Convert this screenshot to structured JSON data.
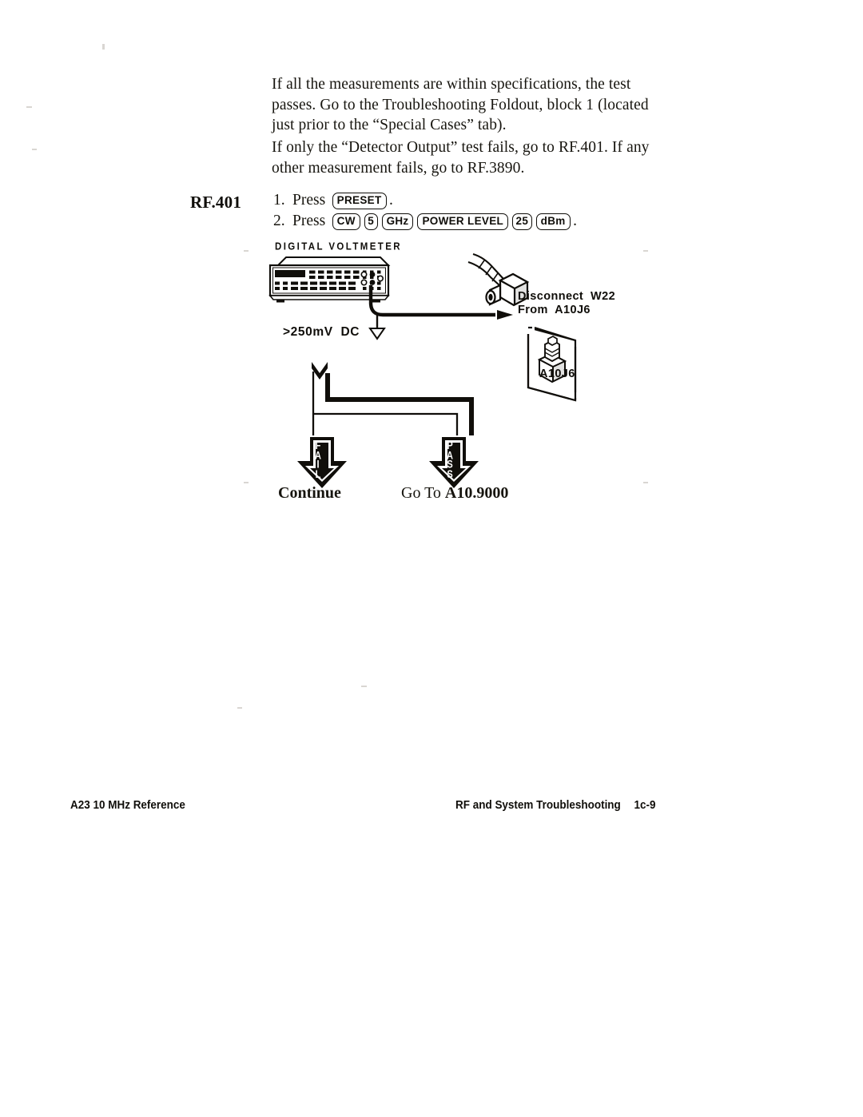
{
  "document": {
    "paragraphs": [
      "If all the measurements are within specifications, the test passes. Go to the Troubleshooting Foldout, block 1 (located just prior to the “Special Cases” tab).",
      "If only the “Detector Output” test fails, go to RF.401. If any other measurement fails, go to RF.3890."
    ]
  },
  "procedure": {
    "id": "RF.401",
    "steps": [
      {
        "number": "1.",
        "verb": "Press",
        "keys": [
          "PRESET"
        ],
        "terminator": "."
      },
      {
        "number": "2.",
        "verb": "Press",
        "keys": [
          "CW",
          "5",
          "GHz",
          "POWER LEVEL",
          "25",
          "dBm"
        ],
        "terminator": "."
      }
    ]
  },
  "diagram": {
    "instrument_label": "DIGITAL VOLTMETER",
    "measurement_label": ">250mV  DC",
    "disconnect_label": "Disconnect  W22\nFrom  A10J6",
    "connector_label": "A10J6",
    "flow": {
      "fail_arrow_text": "FAIL",
      "pass_arrow_text": "PASS",
      "fail_outcome": "Continue",
      "pass_outcome_prefix": "Go To ",
      "pass_outcome_target": "A10.9000"
    }
  },
  "footer": {
    "left": "A23 10 MHz Reference",
    "right": "RF and System Troubleshooting",
    "page_number": "1c-9"
  }
}
